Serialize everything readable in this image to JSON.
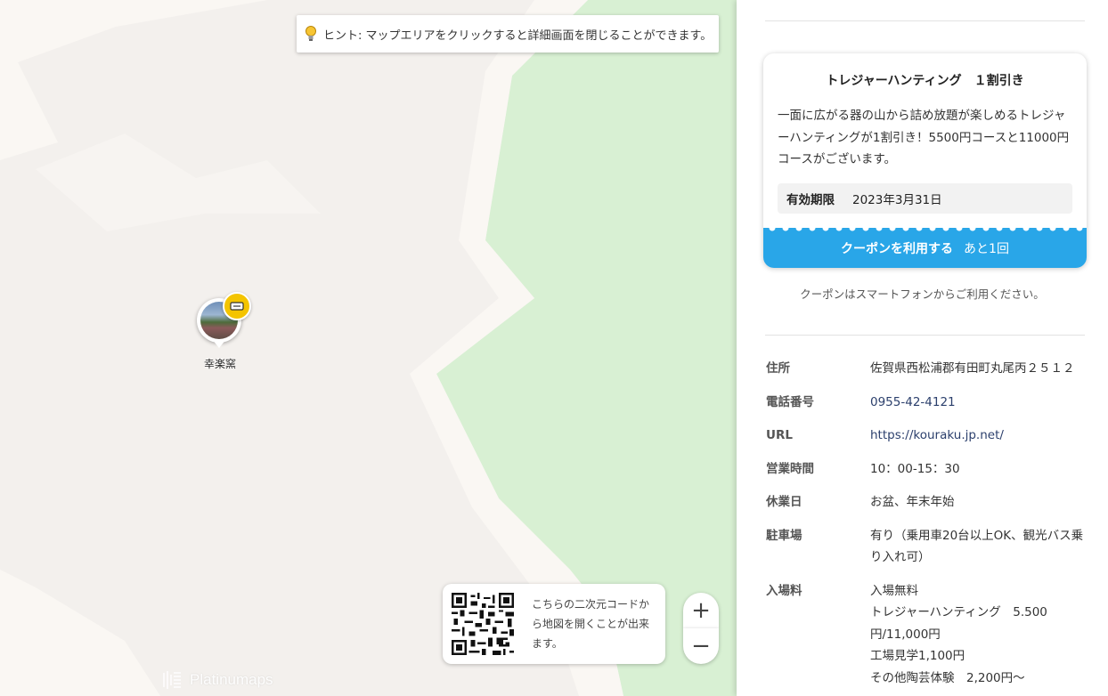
{
  "map": {
    "hint": "ヒント: マップエリアをクリックすると詳細画面を閉じることができます。",
    "marker_label": "幸楽窯",
    "qr_text": "こちらの二次元コードから地図を開くことが出来ます。",
    "zoom_in": "+",
    "zoom_out": "−",
    "brand": "Platinumaps",
    "colors": {
      "land": "#f3f0ed",
      "road": "#faf7f3",
      "park": "#d8f0d3"
    },
    "icons": {
      "hint": "lightbulb-icon",
      "badge": "coupon-ticket-icon"
    }
  },
  "coupon": {
    "title": "トレジャーハンティング　１割引き",
    "description": "一面に広がる器の山から詰め放題が楽しめるトレジャーハンティングが1割引き！5500円コースと11000円コースがございます。",
    "validity_label": "有効期限",
    "validity_value": "2023年3月31日",
    "button_label": "クーポンを利用する",
    "button_remaining": "あと1回",
    "accent": "#29a6e8",
    "note": "クーポンはスマートフォンからご利用ください。"
  },
  "info": {
    "address_label": "住所",
    "address": "佐賀県西松浦郡有田町丸尾丙２５１２",
    "phone_label": "電話番号",
    "phone": "0955-42-4121",
    "url_label": "URL",
    "url": "https://kouraku.jp.net/",
    "hours_label": "営業時間",
    "hours": "10：00-15：30",
    "closed_label": "休業日",
    "closed": "お盆、年末年始",
    "parking_label": "駐車場",
    "parking": "有り（乗用車20台以上OK、観光バス乗り入れ可）",
    "fee_label": "入場料",
    "fee_lines": [
      "入場無料",
      "トレジャーハンティング　5.500円/11,000円",
      "工場見学1,100円",
      "その他陶芸体験　2,200円～"
    ]
  }
}
